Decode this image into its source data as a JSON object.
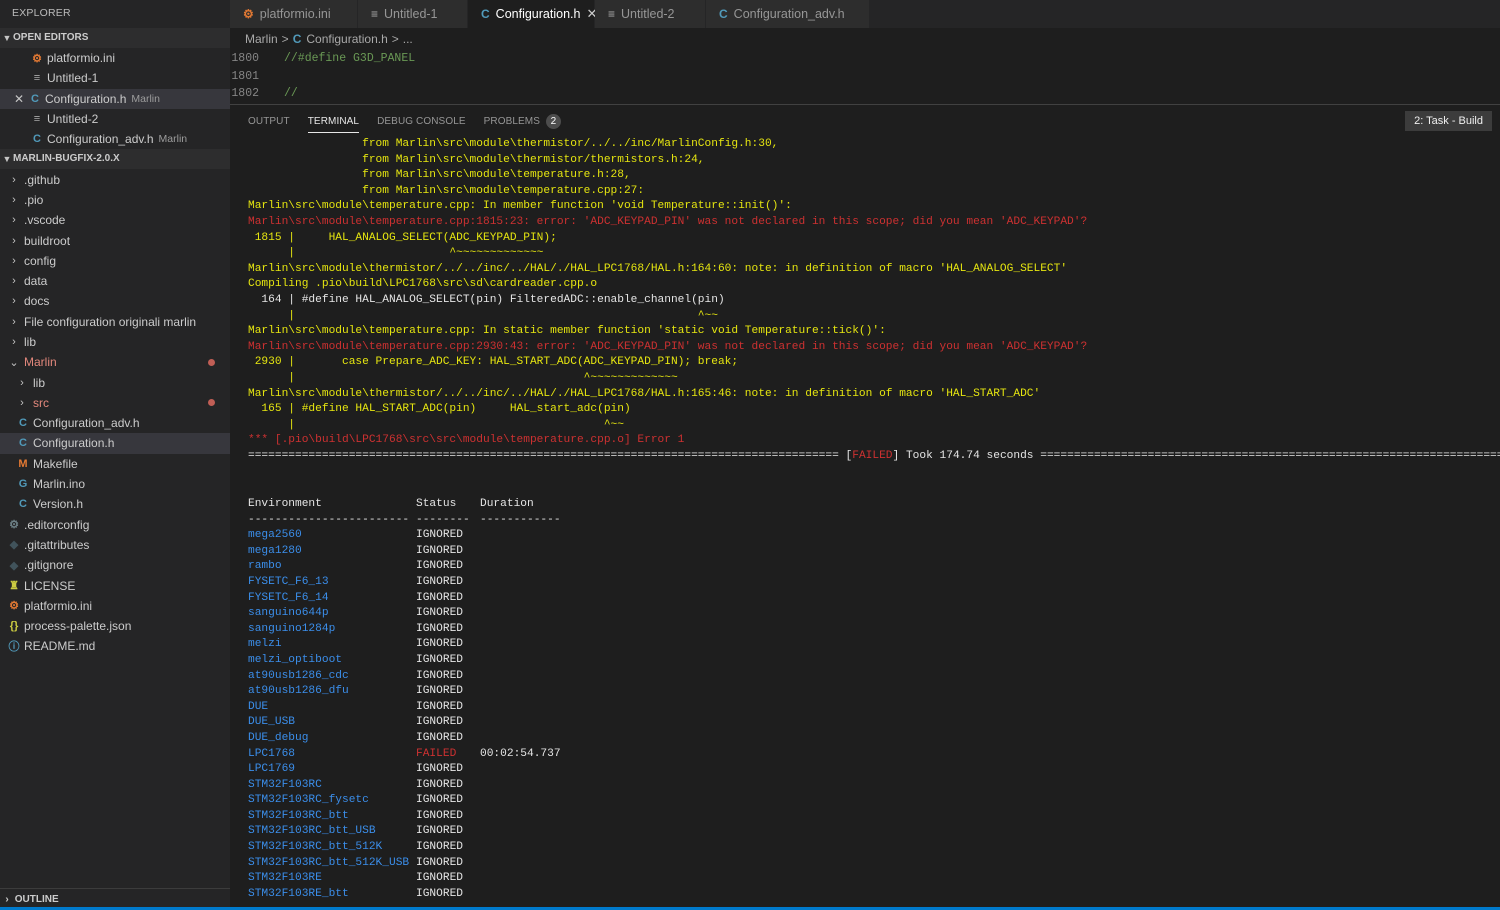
{
  "sidebar": {
    "title": "EXPLORER",
    "open_editors_label": "OPEN EDITORS",
    "open_editors": [
      {
        "icon": "ini-icon",
        "glyph": "⚙",
        "label": "platformio.ini",
        "desc": ""
      },
      {
        "icon": "text-file-icon",
        "glyph": "≡",
        "label": "Untitled-1",
        "desc": ""
      },
      {
        "icon": "c-file-icon",
        "glyph": "C",
        "label": "Configuration.h",
        "desc": "Marlin"
      },
      {
        "icon": "text-file-icon",
        "glyph": "≡",
        "label": "Untitled-2",
        "desc": ""
      },
      {
        "icon": "c-file-icon",
        "glyph": "C",
        "label": "Configuration_adv.h",
        "desc": "Marlin"
      }
    ],
    "workspace_label": "MARLIN-BUGFIX-2.0.X",
    "tree": [
      {
        "label": ".github"
      },
      {
        "label": ".pio"
      },
      {
        "label": ".vscode"
      },
      {
        "label": "buildroot"
      },
      {
        "label": "config"
      },
      {
        "label": "data"
      },
      {
        "label": "docs"
      },
      {
        "label": "File configuration originali marlin"
      },
      {
        "label": "lib"
      },
      {
        "label": "Marlin"
      },
      {
        "label": "lib"
      },
      {
        "label": "src"
      },
      {
        "label": "Configuration_adv.h",
        "glyph": "C"
      },
      {
        "label": "Configuration.h",
        "glyph": "C"
      },
      {
        "label": "Makefile",
        "glyph": "M"
      },
      {
        "label": "Marlin.ino",
        "glyph": "G"
      },
      {
        "label": "Version.h",
        "glyph": "C"
      },
      {
        "label": ".editorconfig",
        "glyph": "⚙"
      },
      {
        "label": ".gitattributes",
        "glyph": "◆"
      },
      {
        "label": ".gitignore",
        "glyph": "◆"
      },
      {
        "label": "LICENSE",
        "glyph": "♜"
      },
      {
        "label": "platformio.ini",
        "glyph": "⚙"
      },
      {
        "label": "process-palette.json",
        "glyph": "{}"
      },
      {
        "label": "README.md",
        "glyph": "ⓘ"
      }
    ],
    "outline_label": "OUTLINE"
  },
  "tabs": [
    {
      "label": "platformio.ini",
      "glyph": "⚙"
    },
    {
      "label": "Untitled-1",
      "glyph": "≡"
    },
    {
      "label": "Configuration.h",
      "glyph": "C",
      "close": "✕"
    },
    {
      "label": "Untitled-2",
      "glyph": "≡"
    },
    {
      "label": "Configuration_adv.h",
      "glyph": "C"
    }
  ],
  "breadcrumb": {
    "root": "Marlin",
    "file": "Configuration.h",
    "more": "...",
    "sep": ">"
  },
  "code_lines": [
    {
      "num": "1800",
      "text": "//#define G3D_PANEL"
    },
    {
      "num": "1801",
      "text": ""
    },
    {
      "num": "1802",
      "text": "//"
    }
  ],
  "panel": {
    "tabs": [
      "OUTPUT",
      "TERMINAL",
      "DEBUG CONSOLE",
      "PROBLEMS"
    ],
    "problems_count": "2",
    "task_select": "2: Task - Build"
  },
  "terminal_lines": [
    {
      "color": "y",
      "text": "                 from Marlin\\src\\module\\thermistor/../../inc/MarlinConfig.h:30,"
    },
    {
      "color": "y",
      "text": "                 from Marlin\\src\\module\\thermistor/thermistors.h:24,"
    },
    {
      "color": "y",
      "text": "                 from Marlin\\src\\module\\temperature.h:28,"
    },
    {
      "color": "y",
      "text": "                 from Marlin\\src\\module\\temperature.cpp:27:"
    },
    {
      "color": "y",
      "text": "Marlin\\src\\module\\temperature.cpp: In member function 'void Temperature::init()':"
    },
    {
      "color": "r",
      "text": "Marlin\\src\\module\\temperature.cpp:1815:23: error: 'ADC_KEYPAD_PIN' was not declared in this scope; did you mean 'ADC_KEYPAD'?"
    },
    {
      "color": "y",
      "text": " 1815 |     HAL_ANALOG_SELECT(ADC_KEYPAD_PIN);"
    },
    {
      "color": "y",
      "text": "      |                       ^~~~~~~~~~~~~~"
    },
    {
      "color": "y",
      "text": "Marlin\\src\\module\\thermistor/../../inc/../HAL/./HAL_LPC1768/HAL.h:164:60: note: in definition of macro 'HAL_ANALOG_SELECT'"
    },
    {
      "color": "y",
      "text": "Compiling .pio\\build\\LPC1768\\src\\sd\\cardreader.cpp.o"
    },
    {
      "color": "w",
      "text": "  164 | #define HAL_ANALOG_SELECT(pin) FilteredADC::enable_channel(pin)"
    },
    {
      "color": "y",
      "text": "      |                                                            ^~~"
    },
    {
      "color": "y",
      "text": "Marlin\\src\\module\\temperature.cpp: In static member function 'static void Temperature::tick()':"
    },
    {
      "color": "r",
      "text": "Marlin\\src\\module\\temperature.cpp:2930:43: error: 'ADC_KEYPAD_PIN' was not declared in this scope; did you mean 'ADC_KEYPAD'?"
    },
    {
      "color": "y",
      "text": " 2930 |       case Prepare_ADC_KEY: HAL_START_ADC(ADC_KEYPAD_PIN); break;"
    },
    {
      "color": "y",
      "text": "      |                                           ^~~~~~~~~~~~~~"
    },
    {
      "color": "y",
      "text": "Marlin\\src\\module\\thermistor/../../inc/../HAL/./HAL_LPC1768/HAL.h:165:46: note: in definition of macro 'HAL_START_ADC'"
    },
    {
      "color": "y",
      "text": "  165 | #define HAL_START_ADC(pin)     HAL_start_adc(pin)"
    },
    {
      "color": "y",
      "text": "      |                                              ^~~"
    },
    {
      "color": "r",
      "text": "*** [.pio\\build\\LPC1768\\src\\src\\module\\temperature.cpp.o] Error 1"
    }
  ],
  "summary": {
    "rule_left": "========================================================================================",
    "failed_word": "FAILED",
    "took_text": " Took 174.74 seconds ",
    "rule_right": "=================================================================================="
  },
  "results": {
    "headers": [
      "Environment",
      "Status",
      "Duration"
    ],
    "underline": [
      "------------------------",
      "--------",
      "------------"
    ],
    "rows": [
      {
        "env": "mega2560",
        "status": "IGNORED",
        "duration": ""
      },
      {
        "env": "mega1280",
        "status": "IGNORED",
        "duration": ""
      },
      {
        "env": "rambo",
        "status": "IGNORED",
        "duration": ""
      },
      {
        "env": "FYSETC_F6_13",
        "status": "IGNORED",
        "duration": ""
      },
      {
        "env": "FYSETC_F6_14",
        "status": "IGNORED",
        "duration": ""
      },
      {
        "env": "sanguino644p",
        "status": "IGNORED",
        "duration": ""
      },
      {
        "env": "sanguino1284p",
        "status": "IGNORED",
        "duration": ""
      },
      {
        "env": "melzi",
        "status": "IGNORED",
        "duration": ""
      },
      {
        "env": "melzi_optiboot",
        "status": "IGNORED",
        "duration": ""
      },
      {
        "env": "at90usb1286_cdc",
        "status": "IGNORED",
        "duration": ""
      },
      {
        "env": "at90usb1286_dfu",
        "status": "IGNORED",
        "duration": ""
      },
      {
        "env": "DUE",
        "status": "IGNORED",
        "duration": ""
      },
      {
        "env": "DUE_USB",
        "status": "IGNORED",
        "duration": ""
      },
      {
        "env": "DUE_debug",
        "status": "IGNORED",
        "duration": ""
      },
      {
        "env": "LPC1768",
        "status": "FAILED",
        "duration": "00:02:54.737"
      },
      {
        "env": "LPC1769",
        "status": "IGNORED",
        "duration": ""
      },
      {
        "env": "STM32F103RC",
        "status": "IGNORED",
        "duration": ""
      },
      {
        "env": "STM32F103RC_fysetc",
        "status": "IGNORED",
        "duration": ""
      },
      {
        "env": "STM32F103RC_btt",
        "status": "IGNORED",
        "duration": ""
      },
      {
        "env": "STM32F103RC_btt_USB",
        "status": "IGNORED",
        "duration": ""
      },
      {
        "env": "STM32F103RC_btt_512K",
        "status": "IGNORED",
        "duration": ""
      },
      {
        "env": "STM32F103RC_btt_512K_USB",
        "status": "IGNORED",
        "duration": ""
      },
      {
        "env": "STM32F103RE",
        "status": "IGNORED",
        "duration": ""
      },
      {
        "env": "STM32F103RE_btt",
        "status": "IGNORED",
        "duration": ""
      }
    ]
  },
  "colors": {
    "accent": "#007acc",
    "terminal_yellow": "#e5e510",
    "terminal_red": "#cd3131",
    "terminal_blue": "#3b8eea"
  }
}
